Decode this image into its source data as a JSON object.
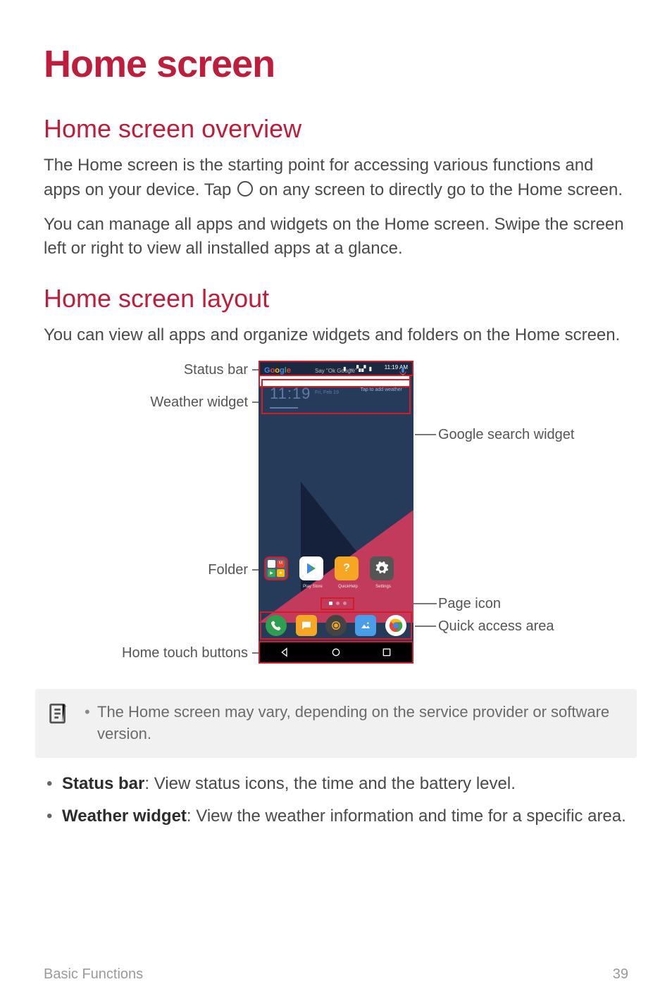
{
  "title": "Home screen",
  "section1": {
    "heading": "Home screen overview",
    "para1_a": "The Home screen is the starting point for accessing various functions and apps on your device. Tap ",
    "para1_b": " on any screen to directly go to the Home screen.",
    "para2": "You can manage all apps and widgets on the Home screen. Swipe the screen left or right to view all installed apps at a glance."
  },
  "section2": {
    "heading": "Home screen layout",
    "para": "You can view all apps and organize widgets and folders on the Home screen."
  },
  "diagram": {
    "labels": {
      "status_bar": "Status bar",
      "weather_widget": "Weather widget",
      "folder": "Folder",
      "home_touch_buttons": "Home touch buttons",
      "google_search_widget": "Google search widget",
      "page_icon": "Page icon",
      "quick_access_area": "Quick access area"
    },
    "phone": {
      "status_time": "11:19 AM",
      "status_icons_alt": "NFC Bluetooth Signal Battery",
      "clock_time": "11:19",
      "clock_date": "Fri, Feb 19",
      "weather_hint": "Tap to add weather",
      "google_logo": "Google",
      "google_hint": "Say \"Ok Google\"",
      "app_labels": {
        "play": "Play Store",
        "help": "QuickHelp",
        "settings": "Settings"
      }
    }
  },
  "note": {
    "item1": "The Home screen may vary, depending on the service provider or software version."
  },
  "bullets": {
    "b1_term": "Status bar",
    "b1_rest": ": View status icons, the time and the battery level.",
    "b2_term": "Weather widget",
    "b2_rest": ": View the weather information and time for a specific area."
  },
  "footer": {
    "section": "Basic Functions",
    "page": "39"
  }
}
